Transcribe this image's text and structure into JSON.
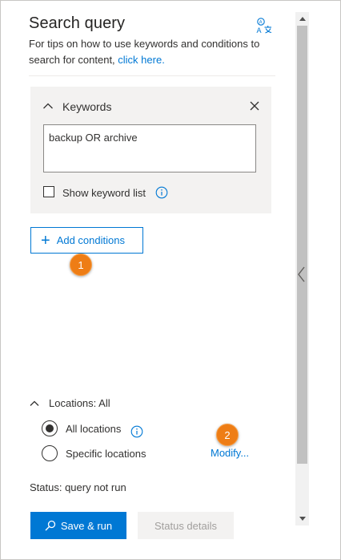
{
  "panel": {
    "title": "Search query",
    "subtitle_text": "For tips on how to use keywords and conditions to search for content, ",
    "subtitle_link": "click here.",
    "language_icon": "language-translate-icon"
  },
  "keywords": {
    "header_label": "Keywords",
    "input_value": "backup OR archive",
    "show_list_label": "Show keyword list",
    "show_list_checked": false
  },
  "conditions": {
    "add_label": "Add conditions"
  },
  "callouts": {
    "one": "1",
    "two": "2"
  },
  "locations": {
    "header_label": "Locations: All",
    "options": [
      {
        "label": "All locations",
        "selected": true
      },
      {
        "label": "Specific locations",
        "selected": false
      }
    ],
    "modify_label": "Modify..."
  },
  "status": {
    "text": "Status: query not run"
  },
  "actions": {
    "save_run_label": "Save & run",
    "status_details_label": "Status details"
  },
  "colors": {
    "accent": "#0078d4",
    "callout": "#ee7d15",
    "panel_bg": "#f3f2f1"
  }
}
